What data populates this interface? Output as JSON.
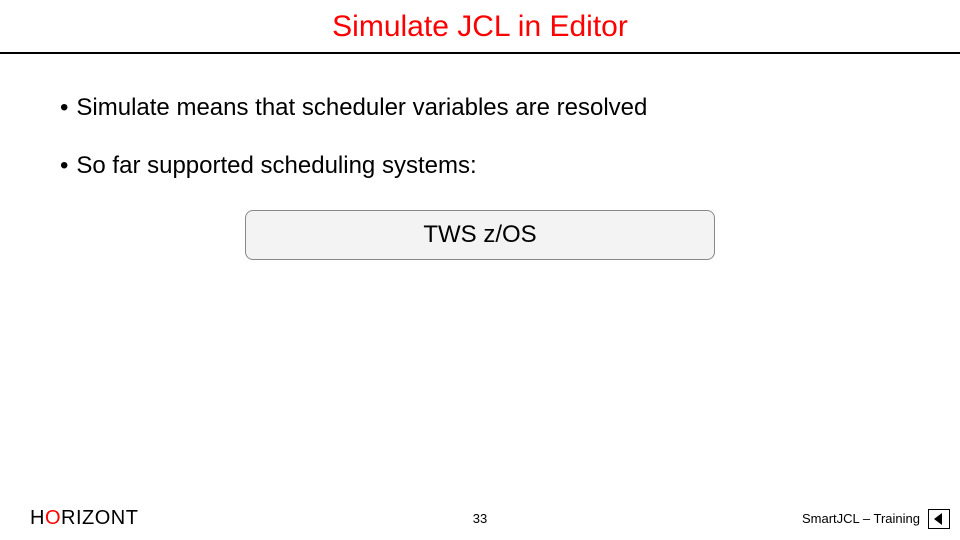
{
  "title": "Simulate JCL in Editor",
  "bullets": [
    "Simulate means that scheduler variables are resolved",
    "So far supported scheduling systems:"
  ],
  "system_box": "TWS z/OS",
  "footer": {
    "brand": {
      "h1": "H",
      "o": "O",
      "rest": "RIZONT"
    },
    "page_number": "33",
    "right_text": "SmartJCL – Training"
  }
}
